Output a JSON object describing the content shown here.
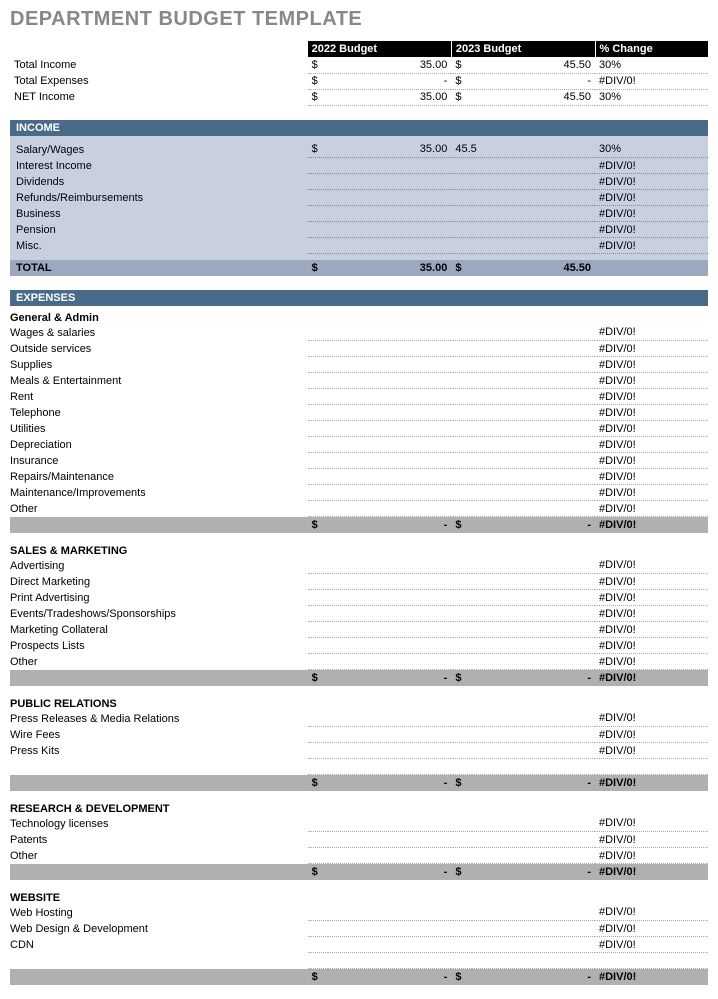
{
  "title": "DEPARTMENT BUDGET TEMPLATE",
  "headers": {
    "budget1": "2022 Budget",
    "budget2": "2023 Budget",
    "change": "% Change"
  },
  "currency": "$",
  "dash": "-",
  "div0": "#DIV/0!",
  "summary": {
    "rows": [
      {
        "label": "Total Income",
        "v1": "35.00",
        "v2": "45.50",
        "change": "30%"
      },
      {
        "label": "Total Expenses",
        "v1": "-",
        "v2": "-",
        "change": "#DIV/0!"
      },
      {
        "label": "NET Income",
        "v1": "35.00",
        "v2": "45.50",
        "change": "30%"
      }
    ]
  },
  "income": {
    "title": "INCOME",
    "rows": [
      {
        "label": "Salary/Wages",
        "sym1": "$",
        "v1": "35.00",
        "v2": "45.5",
        "change": "30%"
      },
      {
        "label": "Interest Income",
        "sym1": "",
        "v1": "",
        "v2": "",
        "change": "#DIV/0!"
      },
      {
        "label": "Dividends",
        "sym1": "",
        "v1": "",
        "v2": "",
        "change": "#DIV/0!"
      },
      {
        "label": "Refunds/Reimbursements",
        "sym1": "",
        "v1": "",
        "v2": "",
        "change": "#DIV/0!"
      },
      {
        "label": "Business",
        "sym1": "",
        "v1": "",
        "v2": "",
        "change": "#DIV/0!"
      },
      {
        "label": "Pension",
        "sym1": "",
        "v1": "",
        "v2": "",
        "change": "#DIV/0!"
      },
      {
        "label": "Misc.",
        "sym1": "",
        "v1": "",
        "v2": "",
        "change": "#DIV/0!"
      }
    ],
    "total": {
      "label": "TOTAL",
      "v1": "35.00",
      "v2": "45.50"
    }
  },
  "expenses": {
    "title": "EXPENSES",
    "groups": [
      {
        "name": "General & Admin",
        "rows": [
          {
            "label": "Wages & salaries"
          },
          {
            "label": "Outside services"
          },
          {
            "label": "Supplies"
          },
          {
            "label": "Meals & Entertainment"
          },
          {
            "label": "Rent"
          },
          {
            "label": "Telephone"
          },
          {
            "label": "Utilities"
          },
          {
            "label": "Depreciation"
          },
          {
            "label": "Insurance"
          },
          {
            "label": "Repairs/Maintenance"
          },
          {
            "label": "Maintenance/Improvements"
          },
          {
            "label": "Other"
          }
        ]
      },
      {
        "name": "SALES & MARKETING",
        "rows": [
          {
            "label": "Advertising"
          },
          {
            "label": "Direct Marketing"
          },
          {
            "label": "Print Advertising"
          },
          {
            "label": "Events/Tradeshows/Sponsorships"
          },
          {
            "label": "Marketing Collateral"
          },
          {
            "label": "Prospects Lists"
          },
          {
            "label": "Other"
          }
        ]
      },
      {
        "name": "PUBLIC RELATIONS",
        "rows": [
          {
            "label": "Press Releases & Media Relations"
          },
          {
            "label": "Wire Fees"
          },
          {
            "label": "Press Kits"
          },
          {
            "label": ""
          }
        ]
      },
      {
        "name": "RESEARCH & DEVELOPMENT",
        "rows": [
          {
            "label": "Technology licenses"
          },
          {
            "label": "Patents"
          },
          {
            "label": "Other"
          }
        ]
      },
      {
        "name": "WEBSITE",
        "rows": [
          {
            "label": "Web Hosting"
          },
          {
            "label": "Web Design & Development"
          },
          {
            "label": "CDN"
          },
          {
            "label": ""
          }
        ]
      }
    ]
  }
}
